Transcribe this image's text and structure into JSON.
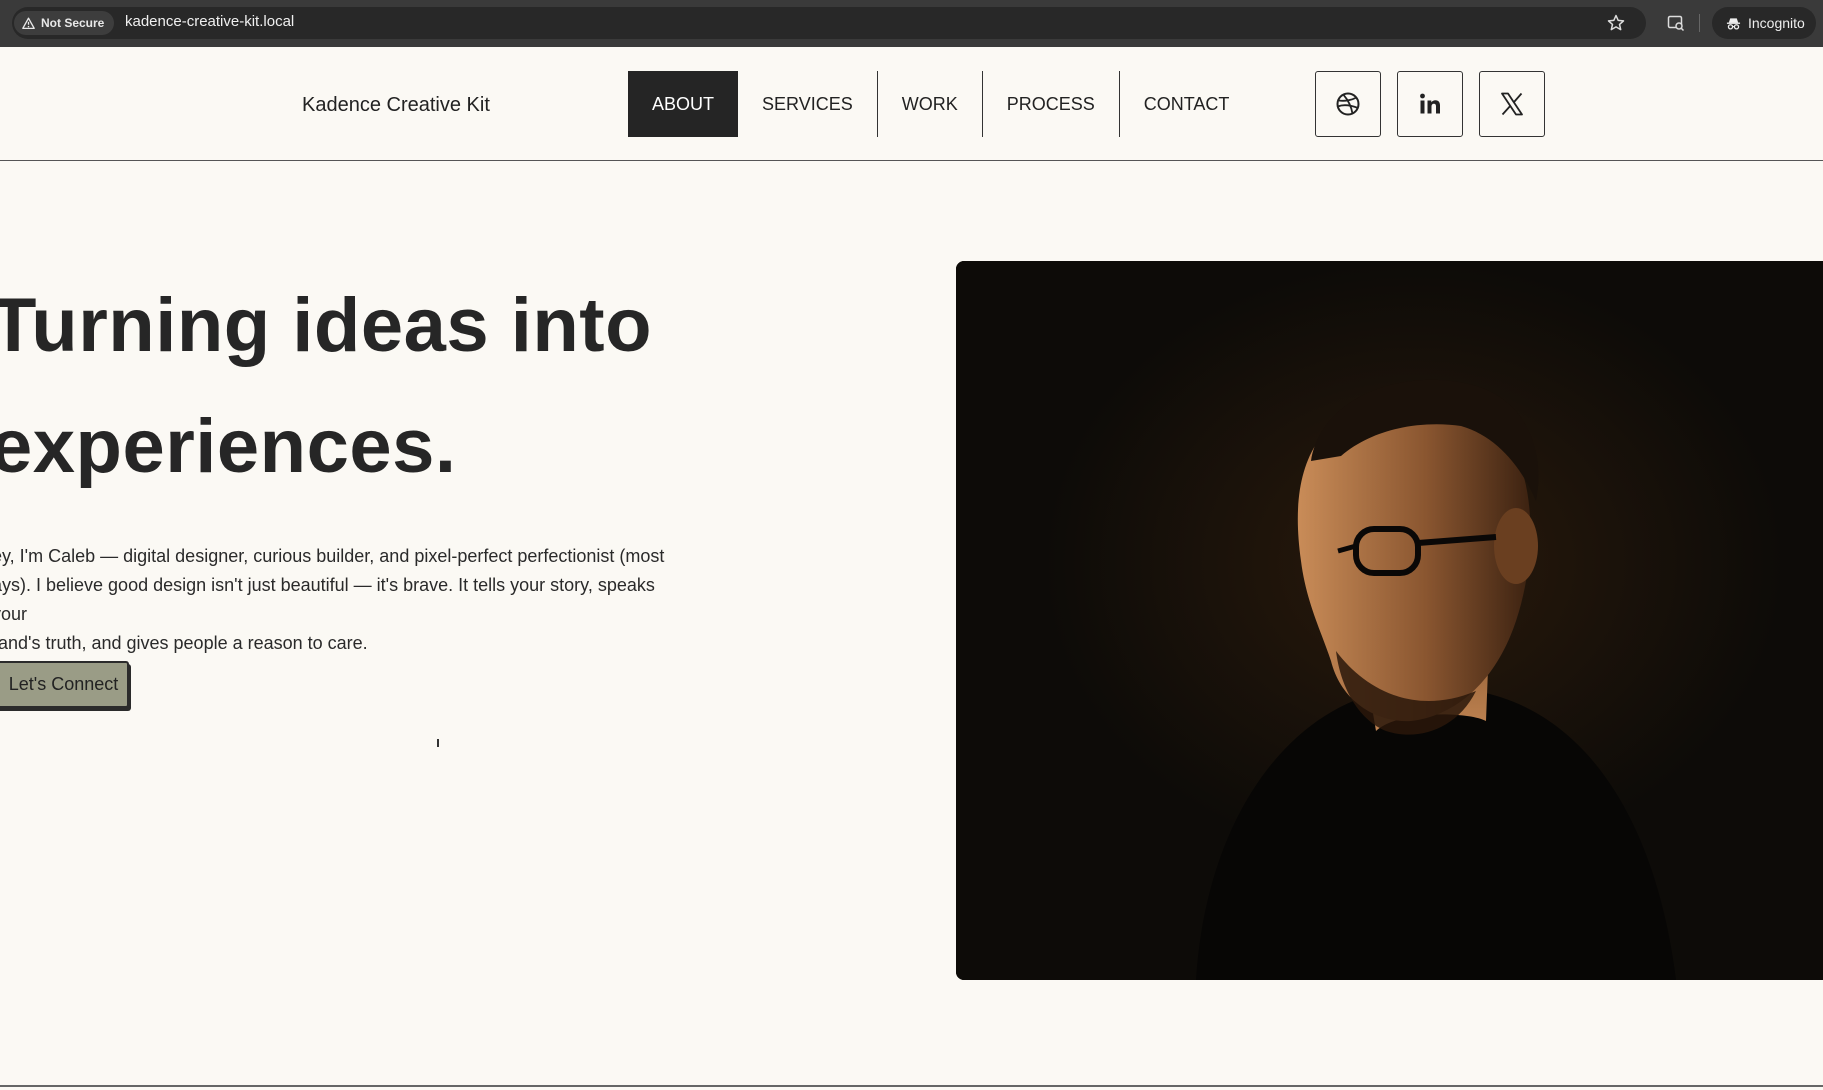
{
  "browser": {
    "security_label": "Not Secure",
    "url": "kadence-creative-kit.local",
    "mode_label": "Incognito"
  },
  "header": {
    "brand": "Kadence Creative Kit",
    "menu": [
      {
        "label": "ABOUT",
        "active": true
      },
      {
        "label": "SERVICES",
        "active": false
      },
      {
        "label": "WORK",
        "active": false
      },
      {
        "label": "PROCESS",
        "active": false
      },
      {
        "label": "CONTACT",
        "active": false
      }
    ],
    "social": [
      "dribbble-icon",
      "linkedin-icon",
      "x-icon"
    ]
  },
  "hero": {
    "title_line_1": "Turning ideas into",
    "title_line_2": "experiences.",
    "intro_line_1": "ey, I'm Caleb — digital designer, curious builder, and pixel-perfect perfectionist (most",
    "intro_line_2": "ays). I believe good design isn't just beautiful — it's brave. It tells your story, speaks your",
    "intro_line_3": "rand's truth, and gives people a reason to care.",
    "cta_label": "Let's Connect"
  },
  "colors": {
    "background": "#fbf9f4",
    "nav_active": "#252525",
    "cta": "#9a9c86",
    "portrait_bg": "#0d0b08"
  }
}
